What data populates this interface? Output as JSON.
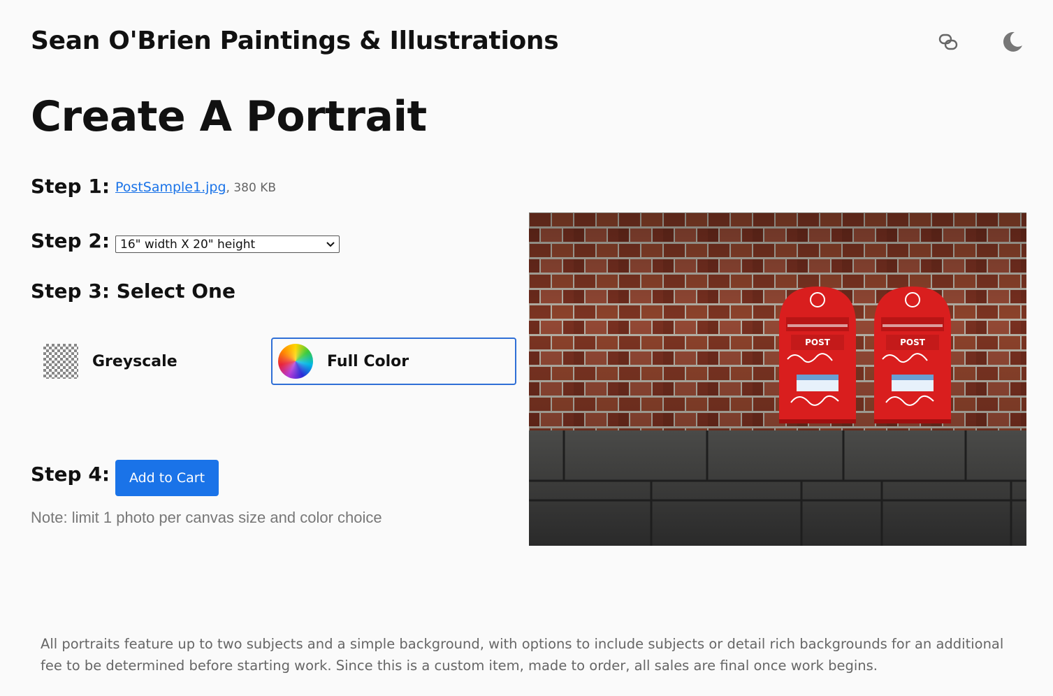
{
  "header": {
    "site_title": "Sean O'Brien Paintings & Illustrations",
    "icons": [
      "link-icon",
      "moon-icon"
    ]
  },
  "main": {
    "page_title": "Create A Portrait",
    "step1": {
      "label": "Step 1:",
      "file_name": "PostSample1.jpg",
      "file_size": ", 380 KB"
    },
    "step2": {
      "label": "Step 2:",
      "selected_size": "16\" width X 20\" height"
    },
    "step3": {
      "label": "Step 3: Select One",
      "options": [
        {
          "label": "Greyscale",
          "selected": false
        },
        {
          "label": "Full Color",
          "selected": true
        }
      ]
    },
    "step4": {
      "label": "Step 4:",
      "button_label": "Add to Cart"
    },
    "note": "Note: limit 1 photo per canvas size and color choice"
  },
  "preview": {
    "subject": "two red post boxes on brick wall",
    "box_labels": [
      "POST",
      "POST"
    ]
  },
  "footer": {
    "text": "All portraits feature up to two subjects and a simple background, with options to include subjects or detail rich backgrounds for an additional fee to be determined before starting work. Since this is a custom item, made to order, all sales are final once work begins."
  },
  "colors": {
    "accent": "#1a73e8",
    "selected_border": "#2f6fd6",
    "background": "#fafafa",
    "postbox_red": "#d91e1e"
  }
}
